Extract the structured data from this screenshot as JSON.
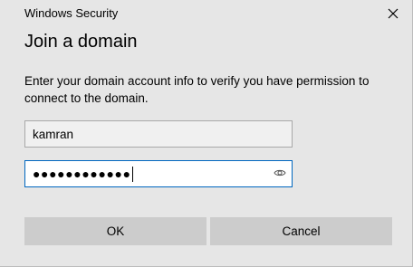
{
  "window": {
    "title": "Windows Security",
    "close_icon": "close-icon"
  },
  "dialog": {
    "heading": "Join a domain",
    "description": "Enter your domain account info to verify you have permission to connect to the domain."
  },
  "username": {
    "value": "kamran"
  },
  "password": {
    "masked_value": "●●●●●●●●●●●●",
    "reveal_icon": "eye-icon"
  },
  "buttons": {
    "ok_label": "OK",
    "cancel_label": "Cancel"
  },
  "colors": {
    "background": "#e6e6e6",
    "focus_border": "#0067c0",
    "button_face": "#cccccc"
  }
}
